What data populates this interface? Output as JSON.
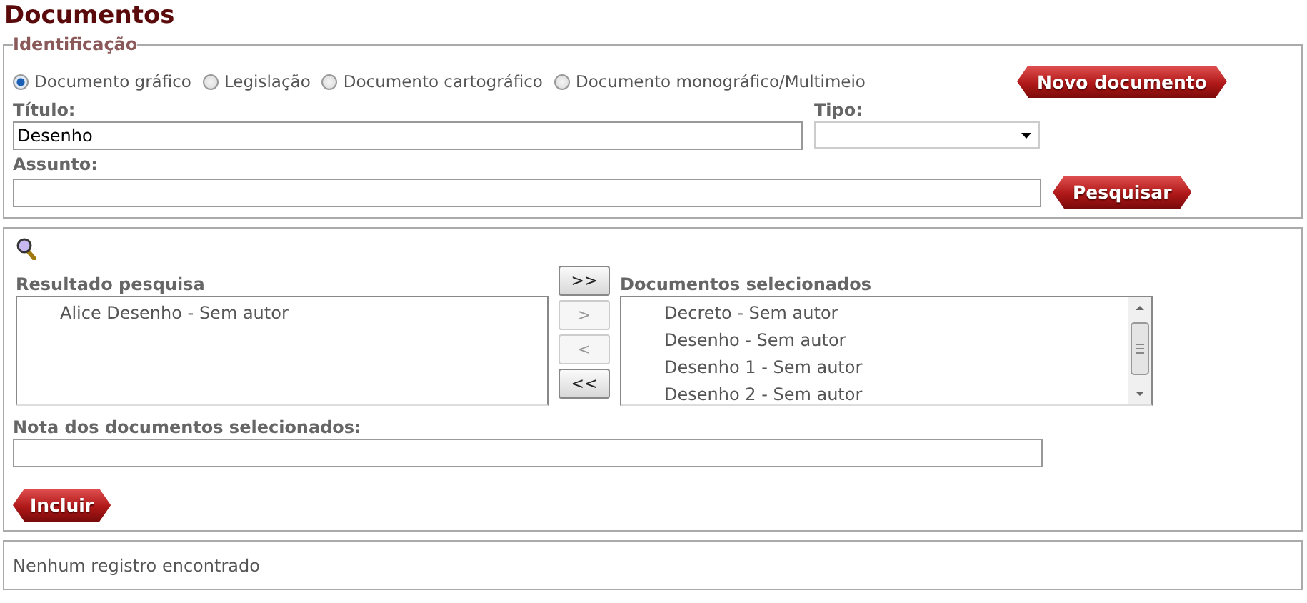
{
  "page_title": "Documentos",
  "identification": {
    "legend": "Identificação",
    "document_types": [
      {
        "label": "Documento gráfico",
        "selected": true
      },
      {
        "label": "Legislação",
        "selected": false
      },
      {
        "label": "Documento cartográfico",
        "selected": false
      },
      {
        "label": "Documento monográfico/Multimeio",
        "selected": false
      }
    ],
    "new_button": "Novo documento",
    "title_field": {
      "label": "Título:",
      "value": "Desenho"
    },
    "type_field": {
      "label": "Tipo:"
    },
    "subject_field": {
      "label": "Assunto:"
    },
    "search_button": "Pesquisar"
  },
  "selection": {
    "results": {
      "label": "Resultado pesquisa",
      "items": [
        "Alice Desenho - Sem autor"
      ]
    },
    "transfer_buttons": [
      {
        "label": ">>",
        "disabled": false
      },
      {
        "label": ">",
        "disabled": true
      },
      {
        "label": "<",
        "disabled": true
      },
      {
        "label": "<<",
        "disabled": false
      }
    ],
    "selected_documents": {
      "label": "Documentos selecionados",
      "items": [
        "Decreto - Sem autor",
        "Desenho - Sem autor",
        "Desenho 1 - Sem autor",
        "Desenho 2 - Sem autor"
      ]
    },
    "note_field": {
      "label": "Nota dos documentos selecionados:"
    },
    "include_button": "Incluir"
  },
  "status_message": "Nenhum registro encontrado"
}
